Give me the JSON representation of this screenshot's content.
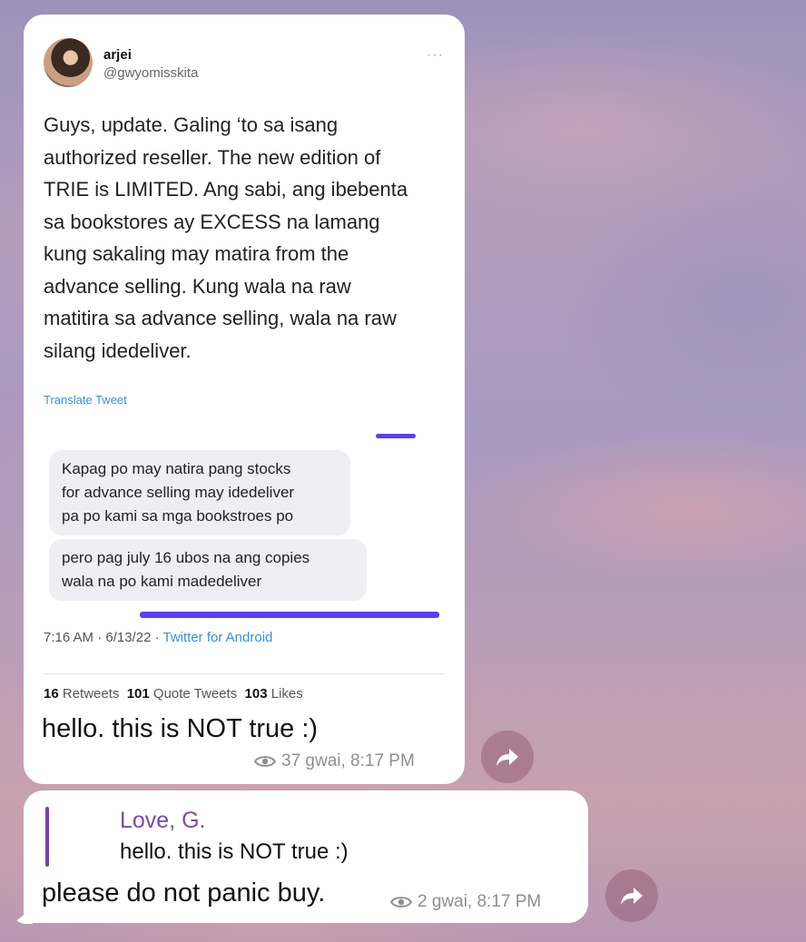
{
  "tweet": {
    "name": "arjei",
    "handle": "@gwyomisskita",
    "more": "···",
    "lines": [
      "Guys, update. Galing ‘to sa isang",
      "authorized reseller. The new edition of",
      "TRIE is LIMITED. Ang sabi, ang ibebenta",
      "sa bookstores ay EXCESS na lamang",
      "kung sakaling may matira from the",
      "advance selling. Kung wala na raw",
      "matitira sa advance selling, wala na raw",
      "silang idedeliver."
    ],
    "translate": "Translate Tweet",
    "chat_bubble_1": [
      "Kapag po may natira pang stocks",
      "for advance selling may idedeliver",
      "pa po kami sa mga bookstroes po"
    ],
    "chat_bubble_2": [
      "pero pag july 16 ubos na ang copies",
      "wala na po kami madedeliver"
    ],
    "time": "7:16 AM · 6/13/22 · ",
    "source": "Twitter for Android",
    "retweets_count": "16",
    "retweets_label": " Retweets  ",
    "quotes_count": "101",
    "quotes_label": " Quote Tweets  ",
    "likes_count": "103",
    "likes_label": " Likes"
  },
  "message1": {
    "text": "hello. this is NOT true :)",
    "views": "37 gwai, 8:17 PM"
  },
  "message2": {
    "reply_name": "Love, G.",
    "reply_text": "hello. this is NOT true :)",
    "text": "please do not panic buy.",
    "views": "2 gwai, 8:17 PM"
  },
  "colors": {
    "reply_accent": "#7b4ba8",
    "twitter_link": "#3a8fd6",
    "chat_purple": "#5b3ff0"
  },
  "icons": [
    "eye-icon",
    "forward-icon",
    "more-icon",
    "avatar"
  ]
}
